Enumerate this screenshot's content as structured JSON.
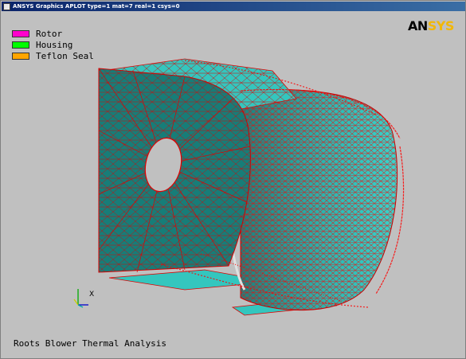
{
  "window": {
    "title": "ANSYS Graphics   APLOT  type=1 mat=7 real=1 csys=0"
  },
  "logo": {
    "an": "AN",
    "sys": "SYS"
  },
  "legend": {
    "items": [
      {
        "label": "Rotor",
        "color": "#ff00cc"
      },
      {
        "label": "Housing",
        "color": "#00ff00"
      },
      {
        "label": "Teflon Seal",
        "color": "#ffa500"
      }
    ]
  },
  "plot_title": "Roots Blower Thermal Analysis",
  "triad": {
    "x_label": "X"
  },
  "colors": {
    "background": "#c0c0c0",
    "mesh_face": "#2a8f8a",
    "mesh_face_light": "#33c7c0",
    "mesh_lines": "#e00000",
    "titlebar": "#0a246a"
  }
}
